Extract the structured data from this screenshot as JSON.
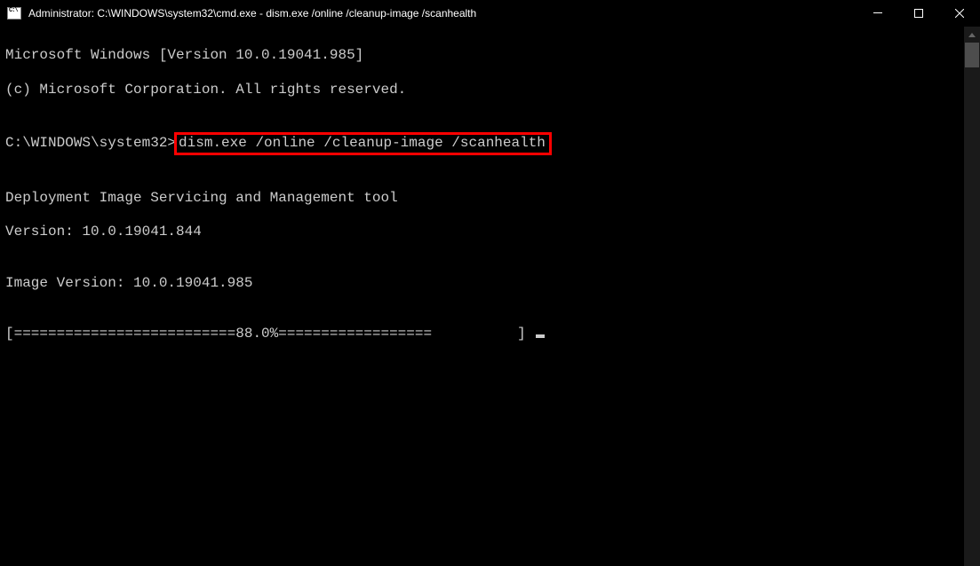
{
  "titlebar": {
    "title": "Administrator: C:\\WINDOWS\\system32\\cmd.exe - dism.exe  /online /cleanup-image /scanhealth"
  },
  "terminal": {
    "line1": "Microsoft Windows [Version 10.0.19041.985]",
    "line2": "(c) Microsoft Corporation. All rights reserved.",
    "blank1": "",
    "prompt": "C:\\WINDOWS\\system32>",
    "command": "dism.exe /online /cleanup-image /scanhealth",
    "blank2": "",
    "line3": "Deployment Image Servicing and Management tool",
    "line4": "Version: 10.0.19041.844",
    "blank3": "",
    "line5": "Image Version: 10.0.19041.985",
    "blank4": "",
    "progress": "[==========================88.0%==================          ] "
  }
}
